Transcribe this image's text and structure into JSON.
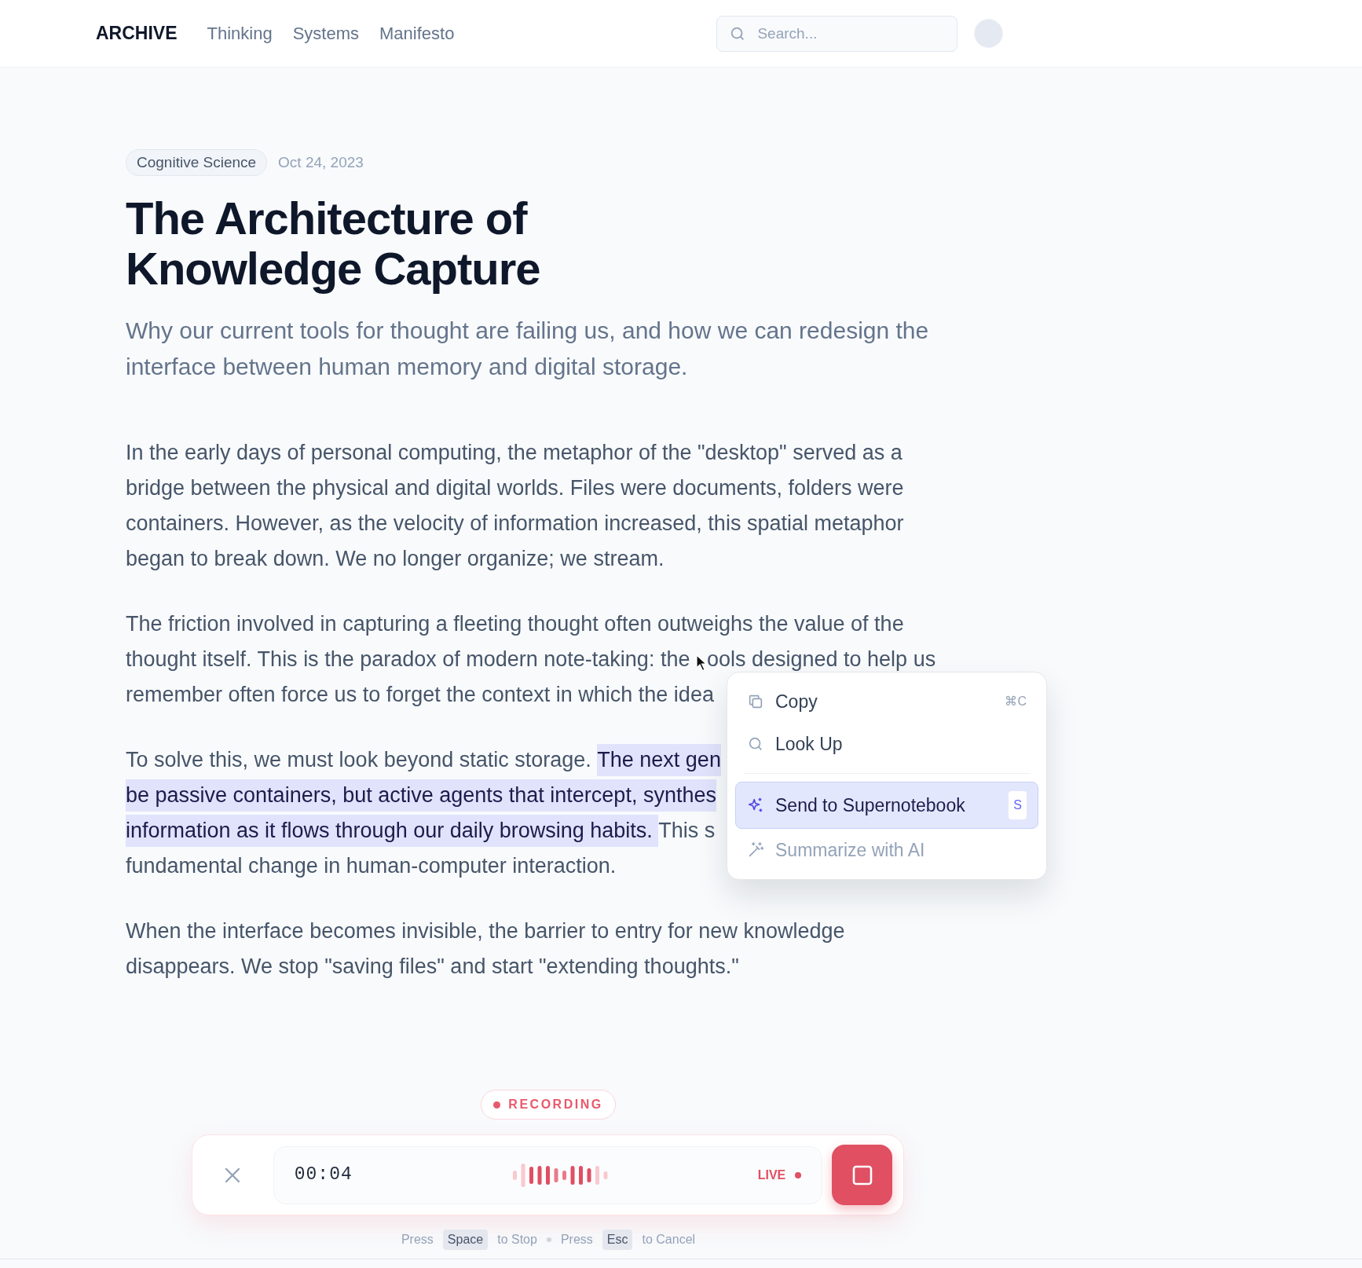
{
  "nav": {
    "logo": "ARCHIVE",
    "links": [
      {
        "label": "Thinking"
      },
      {
        "label": "Systems"
      },
      {
        "label": "Manifesto"
      }
    ],
    "search": {
      "placeholder": "Search..."
    }
  },
  "article": {
    "tag": "Cognitive Science",
    "date": "Oct 24, 2023",
    "title_lines": [
      "The Architecture of",
      "Knowledge Capture"
    ],
    "subtitle_lines": [
      "Why our current tools for thought are failing us, and how we can redesign the",
      "interface between human memory and digital storage."
    ],
    "paragraphs": [
      {
        "lines": [
          [
            {
              "text": "In the early days of personal computing, the metaphor of the \"desktop\" served as a",
              "highlighted": false
            }
          ],
          [
            {
              "text": "bridge between the physical and digital worlds. Files were documents, folders were",
              "highlighted": false
            }
          ],
          [
            {
              "text": "containers. However, as the velocity of information increased, this spatial metaphor",
              "highlighted": false
            }
          ],
          [
            {
              "text": "began to break down. We no longer organize; we stream.",
              "highlighted": false
            }
          ]
        ]
      },
      {
        "lines": [
          [
            {
              "text": "The friction involved in capturing a fleeting thought often outweighs the value of the",
              "highlighted": false
            }
          ],
          [
            {
              "text": "thought itself. This is the paradox of modern note-taking: the ",
              "highlighted": false
            },
            {
              "text": "ools designed to help us",
              "highlighted": false,
              "pointer_before": true
            }
          ],
          [
            {
              "text": "remember often force us to forget the context in which the idea",
              "highlighted": false
            }
          ]
        ]
      },
      {
        "lines": [
          [
            {
              "text": "To solve this, we must look beyond static storage. ",
              "highlighted": false
            },
            {
              "text": "The next gen",
              "highlighted": true
            }
          ],
          [
            {
              "text": "be passive containers, but active agents that intercept, synthes",
              "highlighted": true
            }
          ],
          [
            {
              "text": "information as it flows through our daily browsing habits. ",
              "highlighted": true
            },
            {
              "text": "This s",
              "highlighted": false
            }
          ],
          [
            {
              "text": "fundamental change in human-computer interaction.",
              "highlighted": false
            }
          ]
        ]
      },
      {
        "lines": [
          [
            {
              "text": "When the interface becomes invisible, the barrier to entry for new knowledge",
              "highlighted": false
            }
          ],
          [
            {
              "text": "disappears. We stop \"saving files\" and start \"extending thoughts.\"",
              "highlighted": false
            }
          ]
        ]
      }
    ]
  },
  "context_menu": {
    "groups": [
      [
        {
          "label": "Copy",
          "shortcut": "⌘C",
          "selected": false,
          "disabled": false
        },
        {
          "label": "Look Up",
          "selected": false,
          "disabled": false
        }
      ],
      [
        {
          "label": "Send to Supernotebook",
          "shortcut": "S",
          "selected": true,
          "disabled": false
        },
        {
          "label": "Summarize with AI",
          "selected": false,
          "disabled": true
        }
      ]
    ]
  },
  "recorder": {
    "status": "RECORDING",
    "time": "00:04",
    "live": "LIVE",
    "hints": [
      {
        "prefix": "Press",
        "key": "Space",
        "suffix": "to Stop"
      },
      {
        "prefix": "Press",
        "key": "Esc",
        "suffix": "to Cancel"
      }
    ]
  }
}
